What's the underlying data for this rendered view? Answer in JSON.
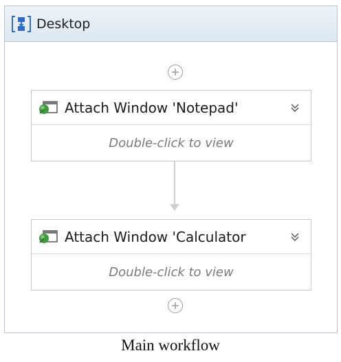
{
  "sequence": {
    "title": "Desktop"
  },
  "activities": [
    {
      "title": "Attach Window 'Notepad'",
      "body_hint": "Double-click to view"
    },
    {
      "title": "Attach Window 'Calculator",
      "body_hint": "Double-click to view"
    }
  ],
  "caption": "Main workflow",
  "colors": {
    "header_bg": "#e4ecf4",
    "border": "#b8c4cf",
    "hint_text": "#7a7a7a",
    "connector": "#cfcfcf",
    "icon_green": "#3f9a3f",
    "icon_blue": "#2e6cc7"
  },
  "icons": {
    "sequence": "sequence-icon",
    "attach_window": "attach-window-icon",
    "collapse": "double-chevron-down-icon",
    "add": "plus-circle-icon"
  }
}
